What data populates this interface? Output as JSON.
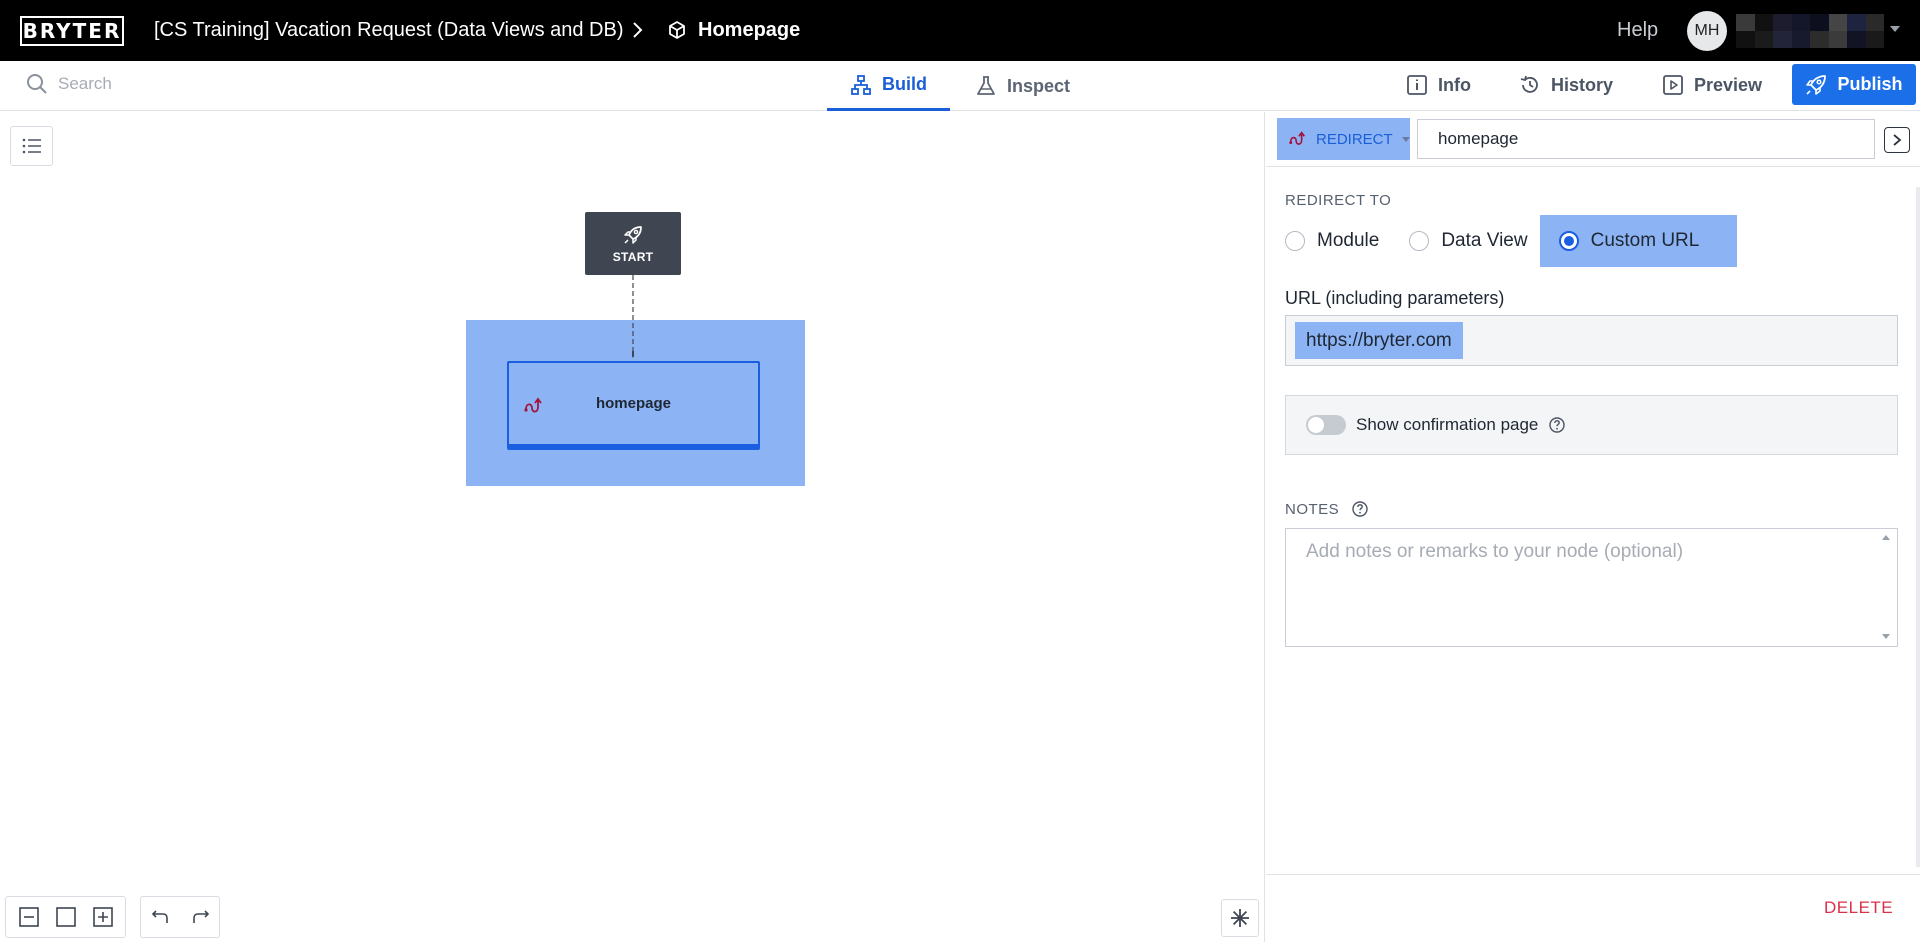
{
  "header": {
    "logo": "BRYTER",
    "app_title": "[CS Training] Vacation Request (Data Views and DB)",
    "page_title": "Homepage",
    "help": "Help",
    "avatar_initials": "MH"
  },
  "toolbar": {
    "search_placeholder": "Search",
    "tabs": [
      {
        "label": "Build",
        "active": true
      },
      {
        "label": "Inspect",
        "active": false
      }
    ],
    "info": "Info",
    "history": "History",
    "preview": "Preview",
    "publish": "Publish"
  },
  "canvas": {
    "start_label": "START",
    "node_label": "homepage"
  },
  "panel": {
    "node_type": "REDIRECT",
    "node_name": "homepage",
    "redirect_to_title": "REDIRECT TO",
    "redirect_options": [
      {
        "label": "Module",
        "selected": false
      },
      {
        "label": "Data View",
        "selected": false
      },
      {
        "label": "Custom URL",
        "selected": true
      }
    ],
    "url_label": "URL (including parameters)",
    "url_value": "https://bryter.com",
    "confirmation_label": "Show confirmation page",
    "confirmation_enabled": false,
    "notes_title": "NOTES",
    "notes_placeholder": "Add notes or remarks to your node (optional)",
    "delete_label": "DELETE"
  },
  "colors": {
    "accent": "#1b6fe8",
    "selection": "#8cb4f5",
    "danger": "#d9304b",
    "topbar": "#000000"
  }
}
